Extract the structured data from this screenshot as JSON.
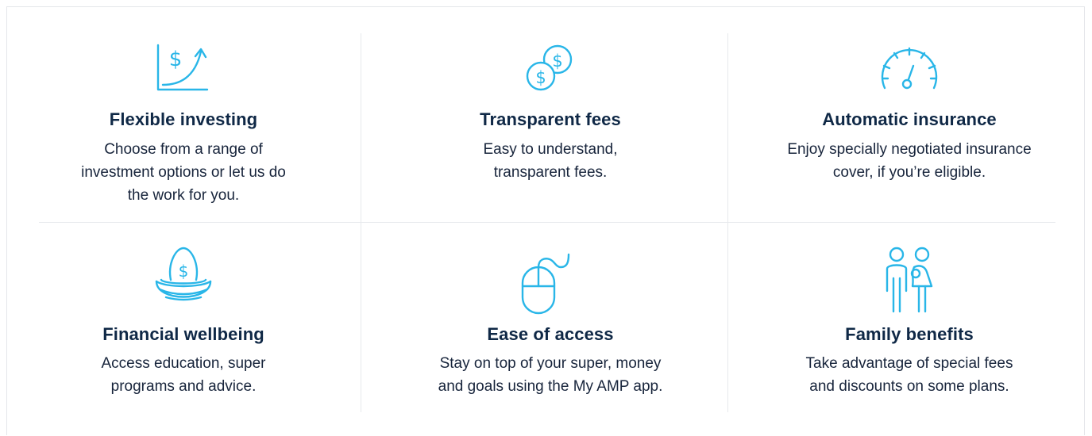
{
  "colors": {
    "accent": "#29b6e8",
    "title": "#0f2846",
    "text": "#17243b",
    "divider": "#e7e9ed"
  },
  "features": [
    {
      "icon": "growth-chart-dollar-icon",
      "title": "Flexible investing",
      "description": "Choose from a range of\ninvestment options or let us do\nthe work for you."
    },
    {
      "icon": "coins-icon",
      "title": "Transparent fees",
      "description": "Easy to understand,\ntransparent fees."
    },
    {
      "icon": "speedometer-icon",
      "title": "Automatic insurance",
      "description": "Enjoy specially negotiated insurance\ncover, if you’re eligible."
    },
    {
      "icon": "nest-egg-dollar-icon",
      "title": "Financial wellbeing",
      "description": "Access education, super\nprograms and advice."
    },
    {
      "icon": "computer-mouse-icon",
      "title": "Ease of access",
      "description": "Stay on top of your super, money\nand goals using the My AMP app."
    },
    {
      "icon": "family-icon",
      "title": "Family benefits",
      "description": "Take advantage of special fees\nand discounts on some plans."
    }
  ]
}
